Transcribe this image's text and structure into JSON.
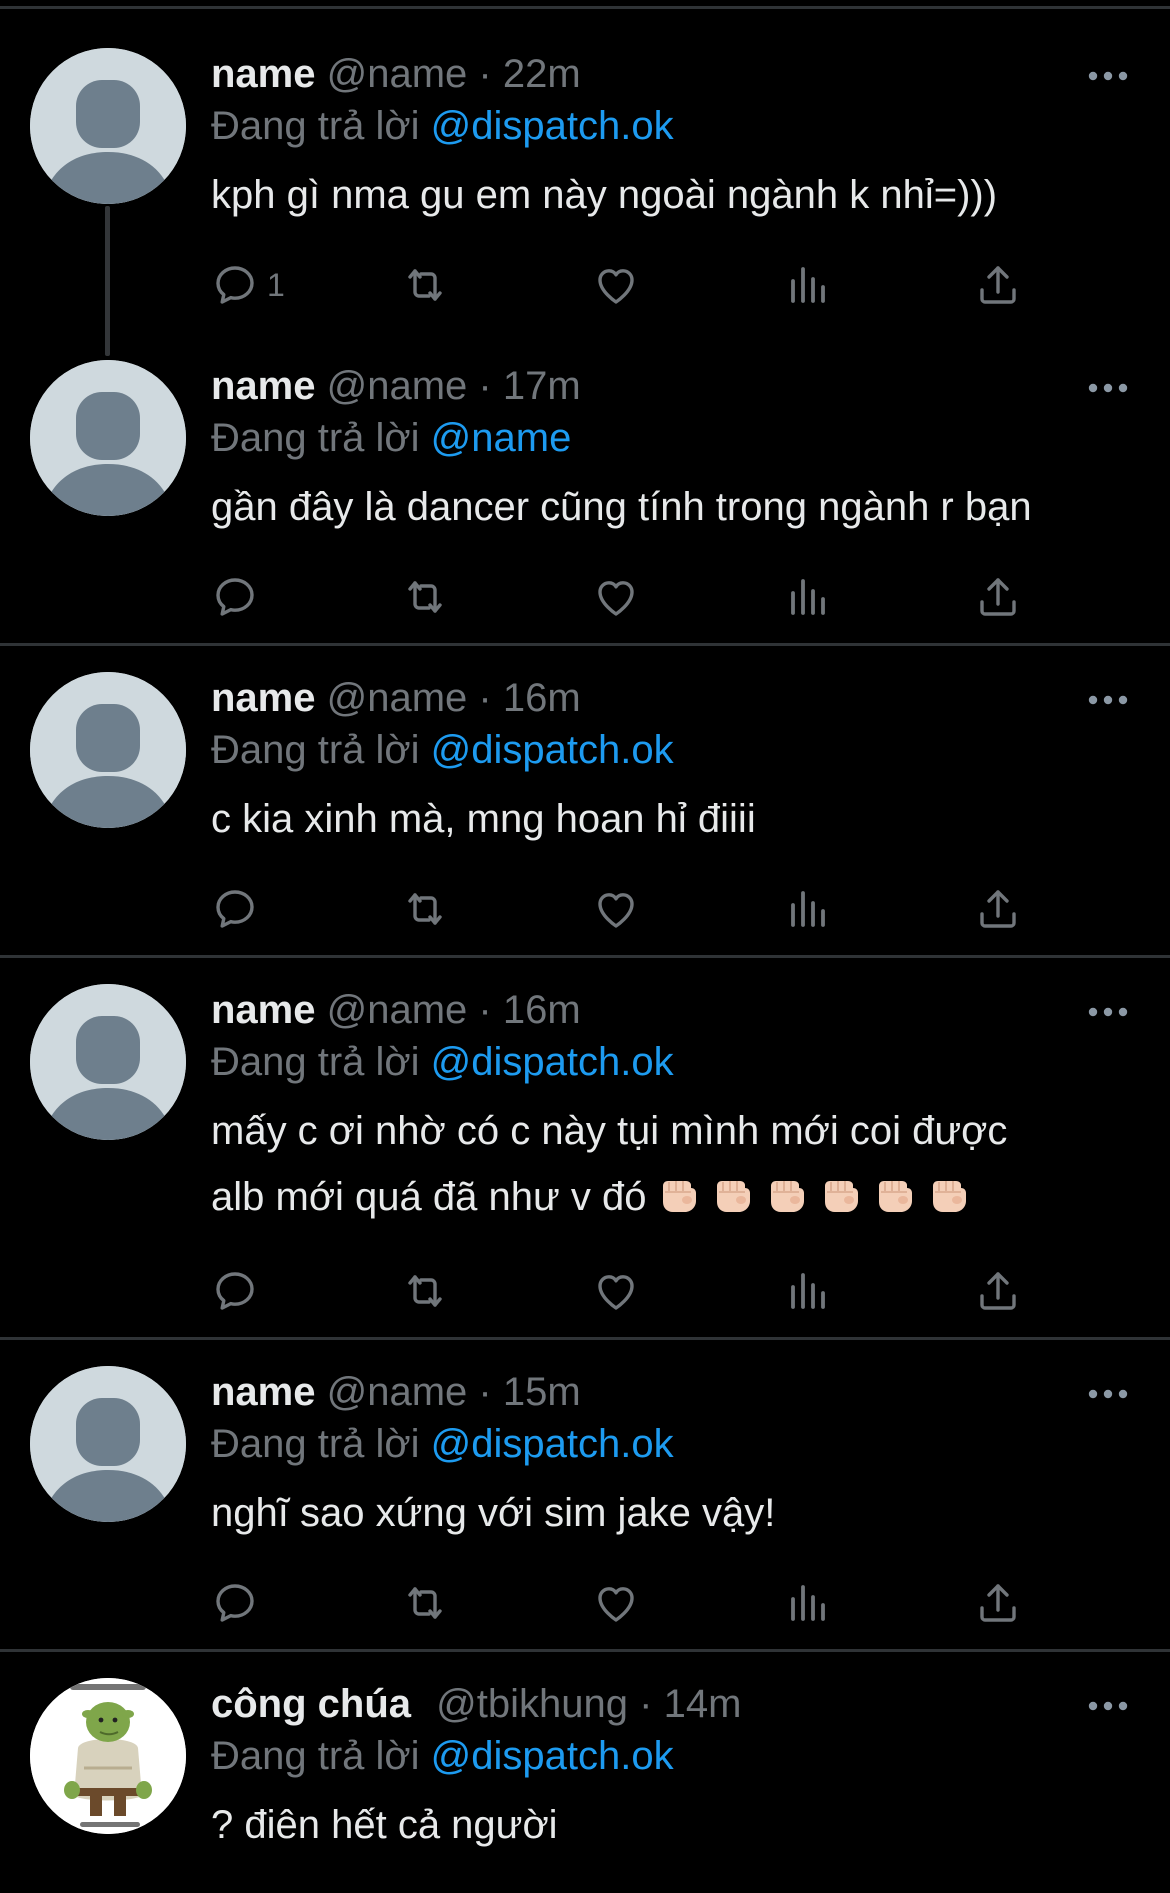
{
  "tweets": [
    {
      "display_name": "name",
      "handle": "@name",
      "separator": "·",
      "time": "22m",
      "reply_prefix": "Đang trả lời",
      "reply_to": "@dispatch.ok",
      "text": "kph gì nma gu em này ngoài ngành k nhỉ=)))",
      "reply_count": "1",
      "avatar": "default-avatar-icon"
    },
    {
      "display_name": "name",
      "handle": "@name",
      "separator": "·",
      "time": "17m",
      "reply_prefix": "Đang trả lời",
      "reply_to": "@name",
      "text": "gần đây là dancer cũng tính trong ngành r bạn",
      "reply_count": "",
      "avatar": "default-avatar-icon"
    },
    {
      "display_name": "name",
      "handle": "@name",
      "separator": "·",
      "time": "16m",
      "reply_prefix": "Đang trả lời",
      "reply_to": "@dispatch.ok",
      "text": "c kia xinh mà, mng hoan hỉ điiii",
      "reply_count": "",
      "avatar": "default-avatar-icon"
    },
    {
      "display_name": "name",
      "handle": "@name",
      "separator": "·",
      "time": "16m",
      "reply_prefix": "Đang trả lời",
      "reply_to": "@dispatch.ok",
      "text_line1": "mấy c ơi nhờ có c này tụi mình mới coi được",
      "text_line2": "alb mới quá đã như v đó",
      "emoji": "fist-bump-emoji",
      "emoji_count": 6,
      "reply_count": "",
      "avatar": "default-avatar-icon"
    },
    {
      "display_name": "name",
      "handle": "@name",
      "separator": "·",
      "time": "15m",
      "reply_prefix": "Đang trả lời",
      "reply_to": "@dispatch.ok",
      "text": "nghĩ sao xứng với sim jake vậy!",
      "reply_count": "",
      "avatar": "default-avatar-icon"
    },
    {
      "display_name": "công chúa",
      "handle": "@tbikhung",
      "separator": "·",
      "time": "14m",
      "reply_prefix": "Đang trả lời",
      "reply_to": "@dispatch.ok",
      "text": "? điên hết cả người",
      "avatar": "ogre-character-avatar"
    }
  ],
  "colors": {
    "background": "#000000",
    "text_primary": "#e7e9ea",
    "text_secondary": "#71767b",
    "mention": "#1d9bf0",
    "divider": "#2f3336",
    "avatar_default_bg": "#cfd9de",
    "avatar_default_fg": "#6e7f8d"
  },
  "icons": {
    "reply": "reply-icon",
    "retweet": "retweet-icon",
    "like": "heart-icon",
    "views": "views-chart-icon",
    "share": "share-icon",
    "more": "more-dots-icon"
  }
}
